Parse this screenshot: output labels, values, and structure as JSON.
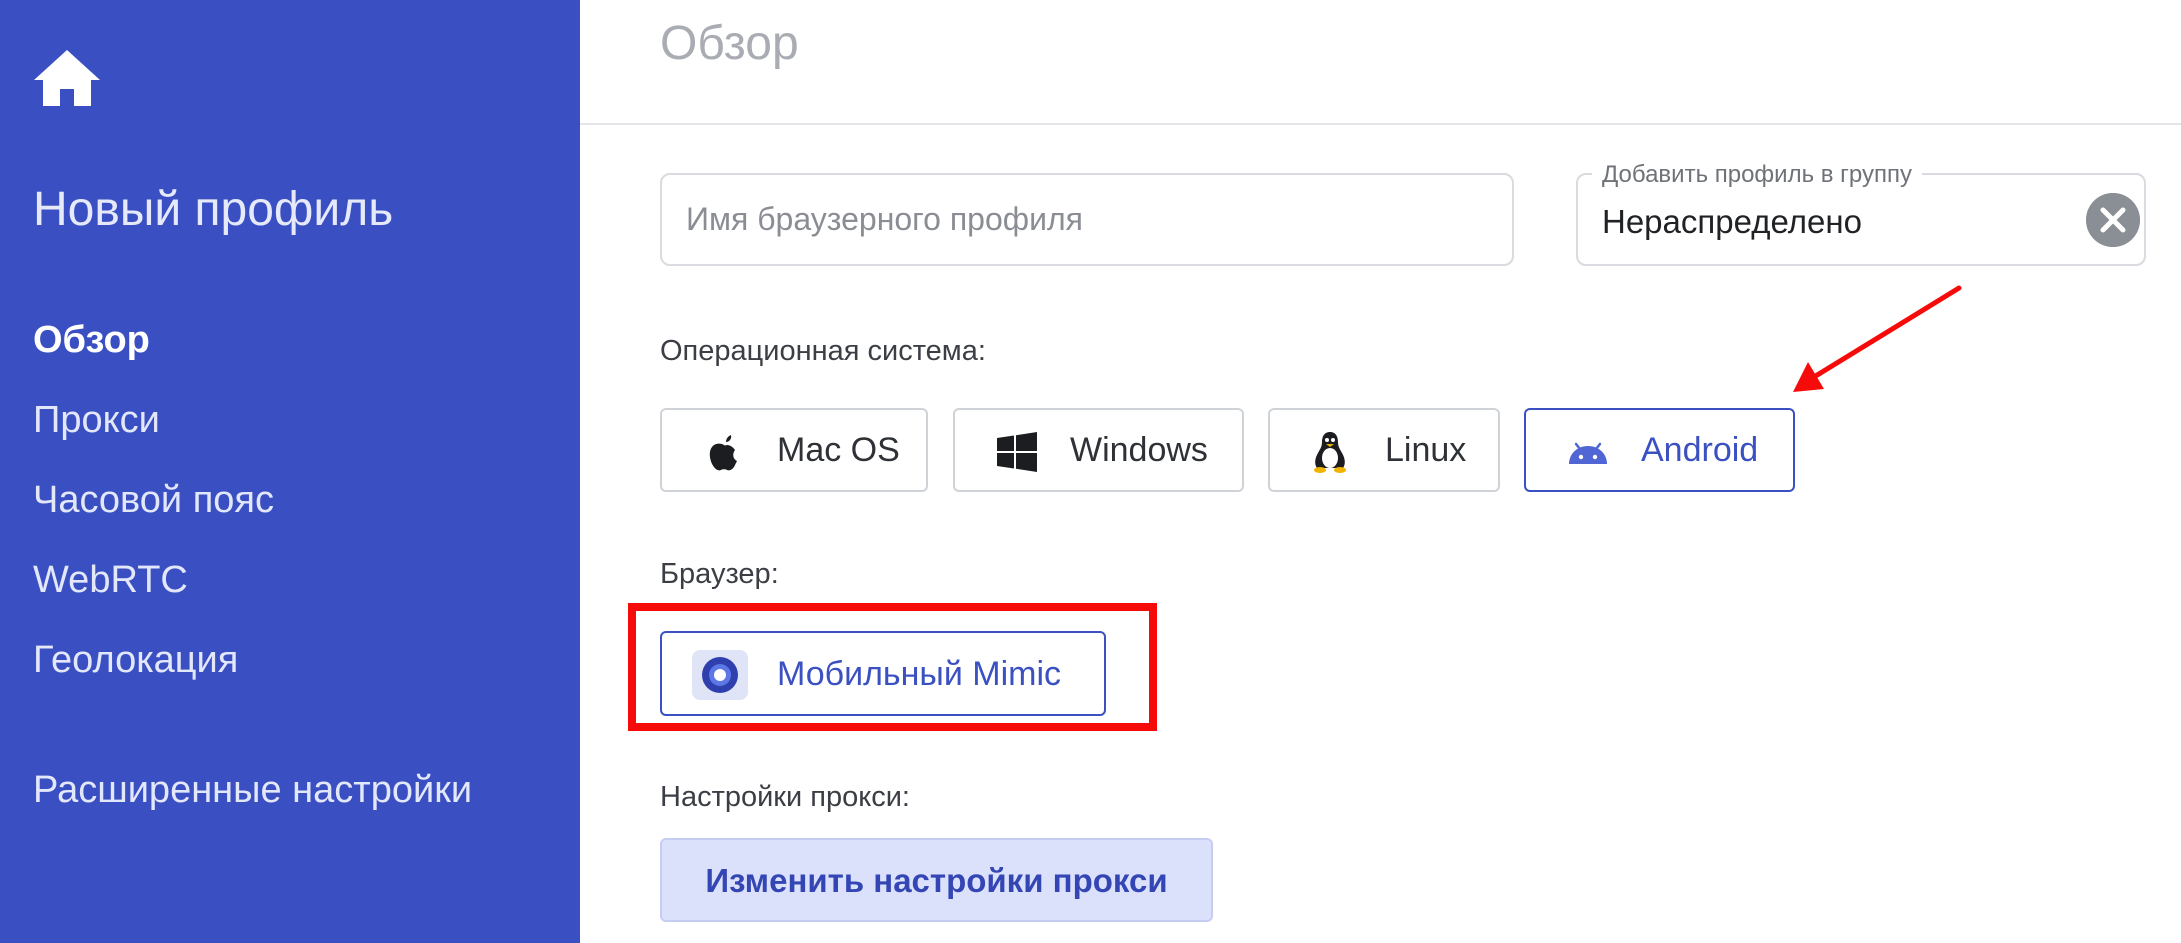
{
  "sidebar": {
    "title": "Новый профиль",
    "items": [
      {
        "label": "Обзор"
      },
      {
        "label": "Прокси"
      },
      {
        "label": "Часовой пояс"
      },
      {
        "label": "WebRTC"
      },
      {
        "label": "Геолокация"
      },
      {
        "label": "Расширенные настройки"
      }
    ],
    "active_item": "Обзор"
  },
  "main": {
    "page_title": "Обзор",
    "profile_name": {
      "placeholder": "Имя браузерного профиля",
      "value": ""
    },
    "group": {
      "label": "Добавить профиль в группу",
      "value": "Нераспределено"
    },
    "os_label": "Операционная система:",
    "os_options": [
      {
        "label": "Mac OS",
        "icon": "apple-icon"
      },
      {
        "label": "Windows",
        "icon": "windows-icon"
      },
      {
        "label": "Linux",
        "icon": "linux-icon"
      },
      {
        "label": "Android",
        "icon": "android-icon"
      }
    ],
    "os_selected": "Android",
    "browser_label": "Браузер:",
    "browser_option": {
      "label": "Мобильный Mimic",
      "icon": "mimic-icon"
    },
    "proxy_label": "Настройки прокси:",
    "proxy_button": "Изменить настройки прокси"
  },
  "colors": {
    "sidebar_bg": "#3a50c2",
    "accent": "#3b50c1",
    "annotation": "#f60b0b",
    "proxy_button_bg": "#dce1fb"
  }
}
